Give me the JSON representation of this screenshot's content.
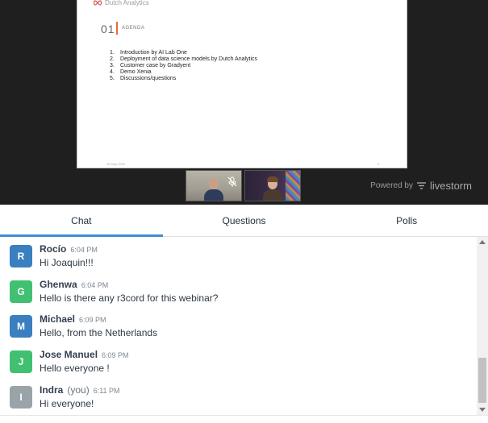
{
  "slide": {
    "logo_text": "Dutch Analytics",
    "section_number": "01",
    "section_title": "AGENDA",
    "agenda": [
      {
        "num": "1.",
        "text": "Introduction by AI Lab One"
      },
      {
        "num": "2.",
        "text": "Deployment of data science models by Dutch Analytics"
      },
      {
        "num": "3.",
        "text": "Customer case by Gradyent"
      },
      {
        "num": "4.",
        "text": "Demo Xenia"
      },
      {
        "num": "5.",
        "text": "Discussions/questions"
      }
    ],
    "footer_date": "28 May 2020",
    "footer_page": "3"
  },
  "powered": {
    "by": "Powered by",
    "brand": "livestorm"
  },
  "tabs": [
    {
      "label": "Chat"
    },
    {
      "label": "Questions"
    },
    {
      "label": "Polls"
    }
  ],
  "messages": [
    {
      "initial": "R",
      "name": "Rocío",
      "you": "",
      "time": "6:04 PM",
      "text": "Hi Joaquin!!!",
      "color": "#3a7fc0"
    },
    {
      "initial": "G",
      "name": "Ghenwa",
      "you": "",
      "time": "6:04 PM",
      "text": "Hello is there any r3cord for this webinar?",
      "color": "#41c072"
    },
    {
      "initial": "M",
      "name": "Michael",
      "you": "",
      "time": "6:09 PM",
      "text": "Hello, from the Netherlands",
      "color": "#3a7fc0"
    },
    {
      "initial": "J",
      "name": "Jose Manuel",
      "you": "",
      "time": "6:09 PM",
      "text": "Hello everyone !",
      "color": "#41c072"
    },
    {
      "initial": "I",
      "name": "Indra",
      "you": "(you)",
      "time": "6:11 PM",
      "text": "Hi everyone!",
      "color": "#9aa3a8"
    }
  ],
  "colors": {
    "accent": "#3a8fd6",
    "stage_bg": "#1f1f1f",
    "slide_bar": "#e76b3c"
  }
}
